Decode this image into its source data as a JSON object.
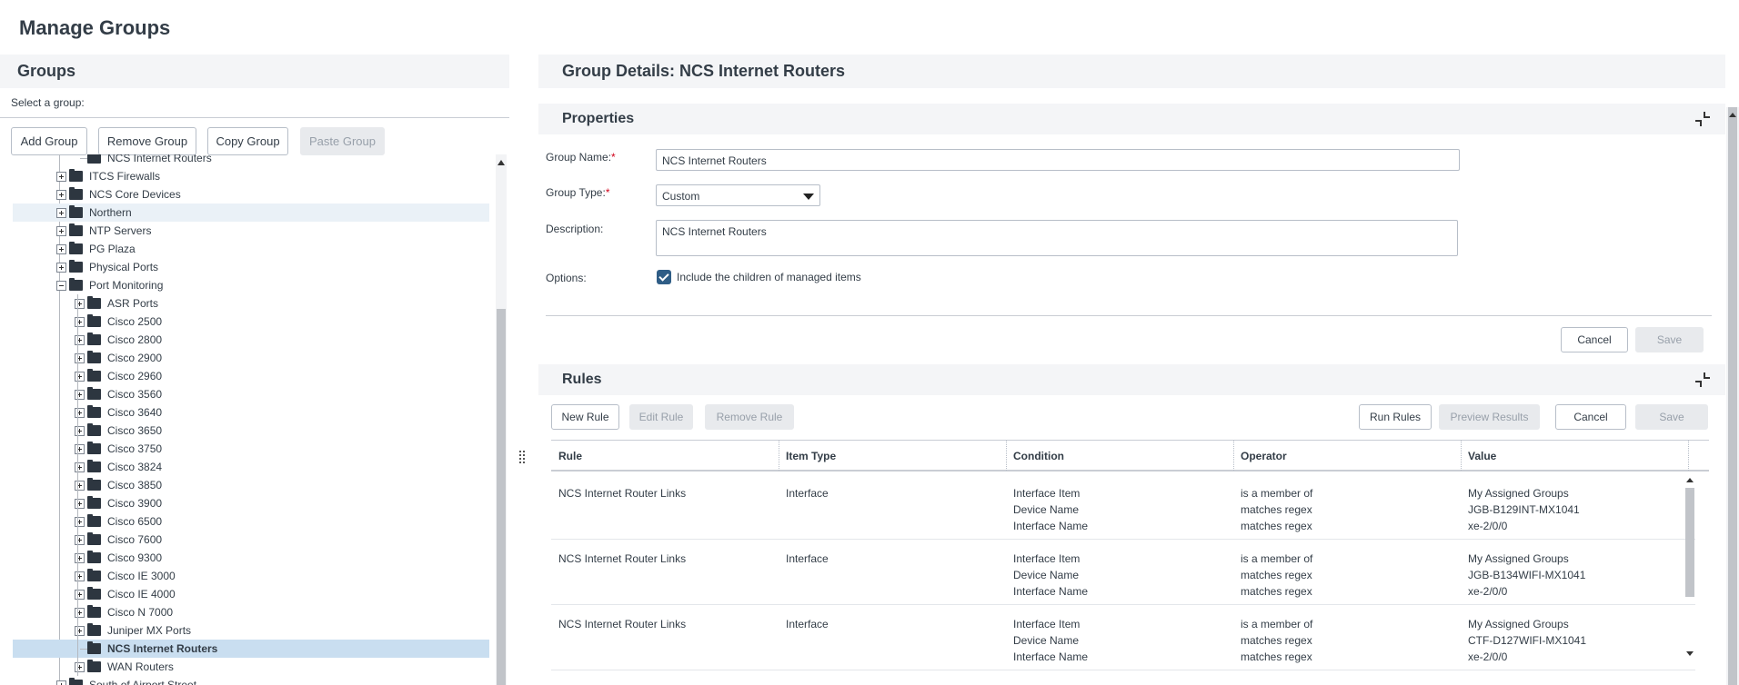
{
  "page_title": "Manage Groups",
  "groups_panel": {
    "title": "Groups",
    "select_label": "Select a group:",
    "buttons": {
      "add": "Add Group",
      "remove": "Remove Group",
      "copy": "Copy Group",
      "paste": "Paste Group"
    }
  },
  "tree": {
    "items": [
      {
        "label": "NCS Internet Routers",
        "level": 2,
        "expander": "none",
        "state": "partial"
      },
      {
        "label": "ITCS Firewalls",
        "level": 1,
        "expander": "plus",
        "state": ""
      },
      {
        "label": "NCS Core Devices",
        "level": 1,
        "expander": "plus",
        "state": ""
      },
      {
        "label": "Northern",
        "level": 1,
        "expander": "plus",
        "state": "hover"
      },
      {
        "label": "NTP Servers",
        "level": 1,
        "expander": "plus",
        "state": ""
      },
      {
        "label": "PG Plaza",
        "level": 1,
        "expander": "plus",
        "state": ""
      },
      {
        "label": "Physical Ports",
        "level": 1,
        "expander": "plus",
        "state": ""
      },
      {
        "label": "Port Monitoring",
        "level": 1,
        "expander": "minus",
        "state": ""
      },
      {
        "label": "ASR Ports",
        "level": 2,
        "expander": "plus",
        "state": ""
      },
      {
        "label": "Cisco 2500",
        "level": 2,
        "expander": "plus",
        "state": ""
      },
      {
        "label": "Cisco 2800",
        "level": 2,
        "expander": "plus",
        "state": ""
      },
      {
        "label": "Cisco 2900",
        "level": 2,
        "expander": "plus",
        "state": ""
      },
      {
        "label": "Cisco 2960",
        "level": 2,
        "expander": "plus",
        "state": ""
      },
      {
        "label": "Cisco 3560",
        "level": 2,
        "expander": "plus",
        "state": ""
      },
      {
        "label": "Cisco 3640",
        "level": 2,
        "expander": "plus",
        "state": ""
      },
      {
        "label": "Cisco 3650",
        "level": 2,
        "expander": "plus",
        "state": ""
      },
      {
        "label": "Cisco 3750",
        "level": 2,
        "expander": "plus",
        "state": ""
      },
      {
        "label": "Cisco 3824",
        "level": 2,
        "expander": "plus",
        "state": ""
      },
      {
        "label": "Cisco 3850",
        "level": 2,
        "expander": "plus",
        "state": ""
      },
      {
        "label": "Cisco 3900",
        "level": 2,
        "expander": "plus",
        "state": ""
      },
      {
        "label": "Cisco 6500",
        "level": 2,
        "expander": "plus",
        "state": ""
      },
      {
        "label": "Cisco 7600",
        "level": 2,
        "expander": "plus",
        "state": ""
      },
      {
        "label": "Cisco 9300",
        "level": 2,
        "expander": "plus",
        "state": ""
      },
      {
        "label": "Cisco IE 3000",
        "level": 2,
        "expander": "plus",
        "state": ""
      },
      {
        "label": "Cisco IE 4000",
        "level": 2,
        "expander": "plus",
        "state": ""
      },
      {
        "label": "Cisco N 7000",
        "level": 2,
        "expander": "plus",
        "state": ""
      },
      {
        "label": "Juniper MX Ports",
        "level": 2,
        "expander": "plus",
        "state": ""
      },
      {
        "label": "NCS Internet Routers",
        "level": 2,
        "expander": "none",
        "state": "selected"
      },
      {
        "label": "WAN Routers",
        "level": 2,
        "expander": "plus",
        "state": ""
      },
      {
        "label": "South of Airport Street",
        "level": 1,
        "expander": "plus",
        "state": ""
      }
    ]
  },
  "details": {
    "title": "Group Details: NCS Internet Routers",
    "properties": {
      "title": "Properties",
      "group_name_label": "Group Name:",
      "group_name_value": "NCS Internet Routers",
      "group_type_label": "Group Type:",
      "group_type_value": "Custom",
      "description_label": "Description:",
      "description_value": "NCS Internet Routers",
      "options_label": "Options:",
      "include_children_label": "Include the children of managed items",
      "include_children_checked": true,
      "required_mark": "*",
      "cancel": "Cancel",
      "save": "Save"
    },
    "rules": {
      "title": "Rules",
      "buttons": {
        "new_rule": "New Rule",
        "edit_rule": "Edit Rule",
        "remove_rule": "Remove Rule",
        "run_rules": "Run Rules",
        "preview_results": "Preview Results",
        "cancel": "Cancel",
        "save": "Save"
      },
      "columns": [
        "Rule",
        "Item Type",
        "Condition",
        "Operator",
        "Value"
      ],
      "rows": [
        {
          "rule": "NCS Internet Router Links",
          "item_type": "Interface",
          "conditions": [
            "Interface Item",
            "Device Name",
            "Interface Name"
          ],
          "operators": [
            "is a member of",
            "matches regex",
            "matches regex"
          ],
          "values": [
            "My Assigned Groups",
            "JGB-B129INT-MX1041",
            "xe-2/0/0"
          ]
        },
        {
          "rule": "NCS Internet Router Links",
          "item_type": "Interface",
          "conditions": [
            "Interface Item",
            "Device Name",
            "Interface Name"
          ],
          "operators": [
            "is a member of",
            "matches regex",
            "matches regex"
          ],
          "values": [
            "My Assigned Groups",
            "JGB-B134WIFI-MX1041",
            "xe-2/0/0"
          ]
        },
        {
          "rule": "NCS Internet Router Links",
          "item_type": "Interface",
          "conditions": [
            "Interface Item",
            "Device Name",
            "Interface Name"
          ],
          "operators": [
            "is a member of",
            "matches regex",
            "matches regex"
          ],
          "values": [
            "My Assigned Groups",
            "CTF-D127WIFI-MX1041",
            "xe-2/0/0"
          ]
        }
      ]
    }
  },
  "colors": {
    "header_bg": "#f4f5f7",
    "selected_row": "#c9def0",
    "hover_row": "#eaf1f7",
    "checkbox": "#2f5d86",
    "required": "#d0021b"
  }
}
